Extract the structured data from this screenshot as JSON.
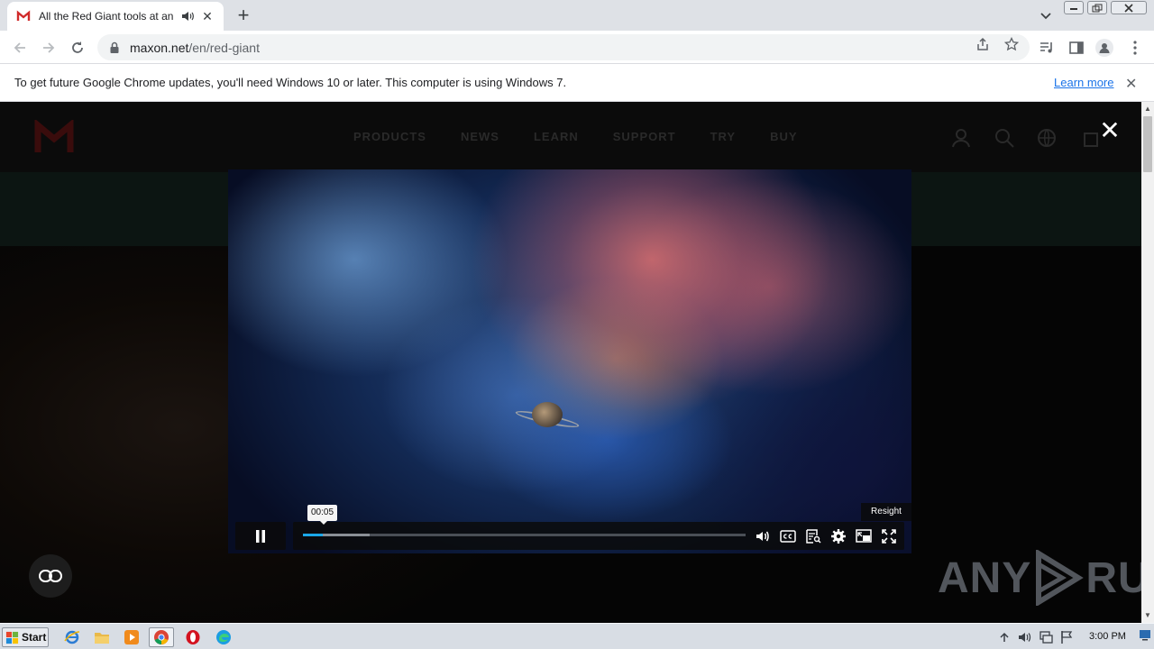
{
  "browser": {
    "tab": {
      "title": "All the Red Giant tools at an affordable price | Maxon"
    },
    "omnibox": {
      "host": "maxon.net",
      "path": "/en/red-giant"
    },
    "infobar": {
      "message": "To get future Google Chrome updates, you'll need Windows 10 or later. This computer is using Windows 7.",
      "learn_more": "Learn more"
    }
  },
  "site": {
    "nav": [
      "PRODUCTS",
      "NEWS",
      "LEARN",
      "SUPPORT",
      "TRY",
      "BUY"
    ]
  },
  "video": {
    "time_tooltip": "00:05",
    "resight_label": "Resight",
    "progress_played": 0.045,
    "progress_buffered": 0.15
  },
  "watermark": {
    "left": "ANY",
    "right": "RUN"
  },
  "taskbar": {
    "start_label": "Start",
    "clock": "3:00 PM"
  },
  "colors": {
    "accent_progress": "#1aa7e8",
    "link": "#1a73e8",
    "brand_red": "#d02a2a"
  }
}
